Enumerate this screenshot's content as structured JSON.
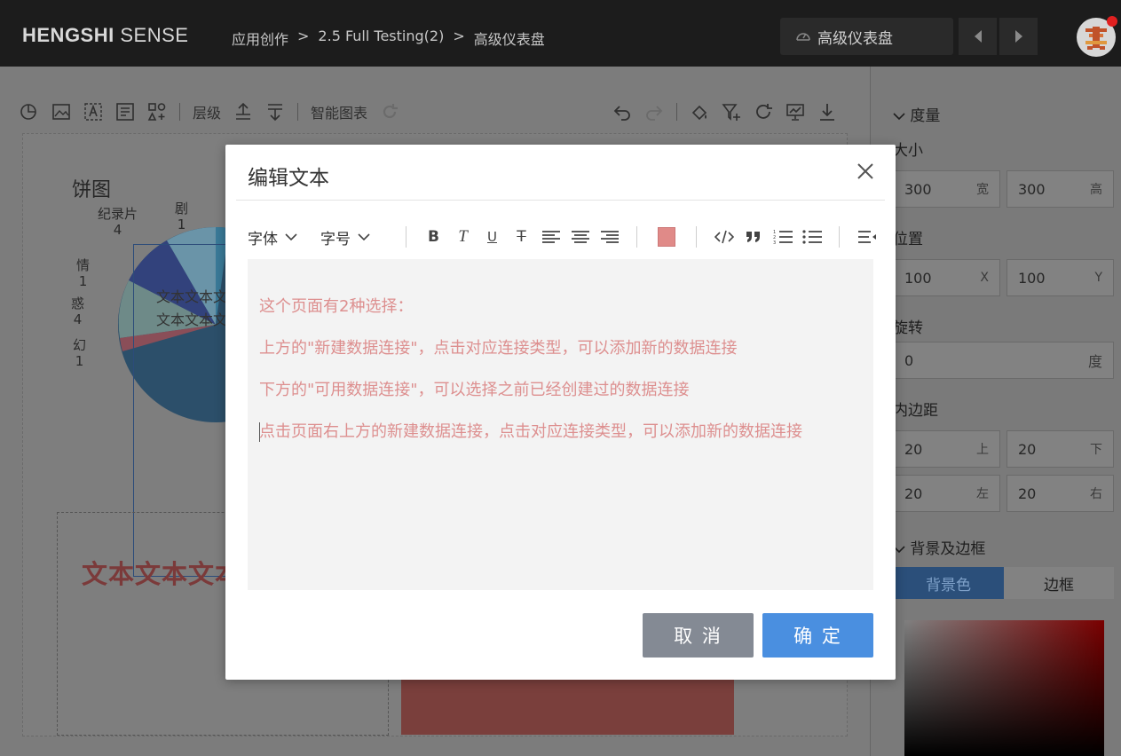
{
  "app": {
    "logo_bold": "HENGSHI",
    "logo_light": " SENSE",
    "breadcrumb": [
      "应用创作",
      ">",
      "2.5 Full Testing(2)",
      ">",
      "高级仪表盘"
    ],
    "dashboard_select": "高级仪表盘"
  },
  "toolbar": {
    "layer_label": "层级",
    "smart_chart_label": "智能图表"
  },
  "canvas": {
    "chart_title": "饼图",
    "pie_labels": [
      {
        "name": "纪录片",
        "value": "4"
      },
      {
        "name": "剧",
        "value": "1"
      },
      {
        "name": "情",
        "value": "1"
      },
      {
        "name": "惑",
        "value": "4"
      },
      {
        "name": "幻",
        "value": "1"
      }
    ],
    "bg_text_lines": [
      "文本文本文",
      "文本文本文"
    ],
    "big_text": "文本文本文本"
  },
  "right_panel": {
    "measure_section": "度量",
    "size_label": "大小",
    "size_width": "300",
    "size_width_unit": "宽",
    "size_height": "300",
    "size_height_unit": "高",
    "position_label": "位置",
    "pos_x": "100",
    "pos_x_unit": "X",
    "pos_y": "100",
    "pos_y_unit": "Y",
    "rotation_label": "旋转",
    "rotation_value": "0",
    "rotation_unit": "度",
    "padding_label": "内边距",
    "pad_top": "20",
    "pad_top_unit": "上",
    "pad_bottom": "20",
    "pad_bottom_unit": "下",
    "pad_left": "20",
    "pad_left_unit": "左",
    "pad_right": "20",
    "pad_right_unit": "右",
    "bg_border_section": "背景及边框",
    "tab_bg": "背景色",
    "tab_border": "边框"
  },
  "modal": {
    "title": "编辑文本",
    "font_dropdown": "字体",
    "size_dropdown": "字号",
    "bold": "B",
    "italic": "T",
    "underline": "U",
    "strike": "T",
    "text_color": "#e08a88",
    "content": [
      "这个页面有2种选择：",
      "上方的\"新建数据连接\"，点击对应连接类型，可以添加新的数据连接",
      "下方的\"可用数据连接\"，可以选择之前已经创建过的数据连接",
      "点击页面右上方的新建数据连接，点击对应连接类型，可以添加新的数据连接"
    ],
    "cancel_label": "取 消",
    "ok_label": "确 定"
  },
  "colors": {
    "primary": "#4a8fe0",
    "cancel": "#848a94",
    "content_text": "#dd8f8f"
  }
}
